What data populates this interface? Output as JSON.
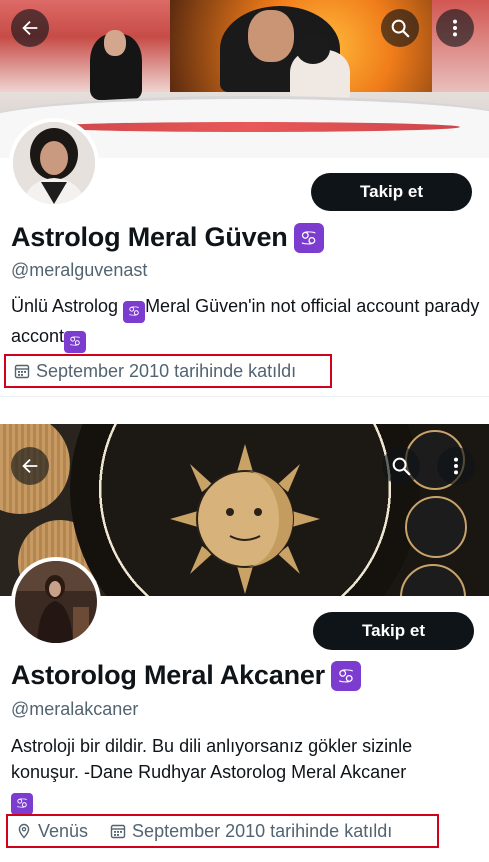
{
  "profiles": [
    {
      "banner": "tv-studio-photo",
      "avatar": "woman-portrait",
      "follow_label": "Takip et",
      "name": "Astrolog Meral Güven",
      "badge_glyph": "♋",
      "handle": "@meralguvenast",
      "bio_part1": "Ünlü Astrolog ",
      "bio_badge": "♋",
      "bio_part2": "Meral Güven'in not official account parady accont",
      "bio_badge2": "♋",
      "joined": "September 2010 tarihinde katıldı"
    },
    {
      "banner": "zodiac-sun-moon-illustration",
      "avatar": "woman-seated-portrait",
      "follow_label": "Takip et",
      "name": "Astorolog Meral Akcaner",
      "badge_glyph": "♋",
      "handle": "@meralakcaner",
      "bio_text": "Astroloji bir dildir. Bu dili anlıyorsanız gökler sizinle konuşur.  -Dane Rudhyar  Astorolog Meral Akcaner",
      "bio_badge": "♋",
      "location": "Venüs",
      "joined": "September 2010 tarihinde katıldı"
    }
  ],
  "icons": {
    "back": "arrow-left-icon",
    "search": "search-icon",
    "more": "more-vertical-icon",
    "calendar": "calendar-icon",
    "location": "location-pin-icon"
  },
  "colors": {
    "badge": "#7c3ccf",
    "highlight_border": "#d0021b",
    "follow_bg": "#0f1419",
    "secondary_text": "#536471"
  }
}
